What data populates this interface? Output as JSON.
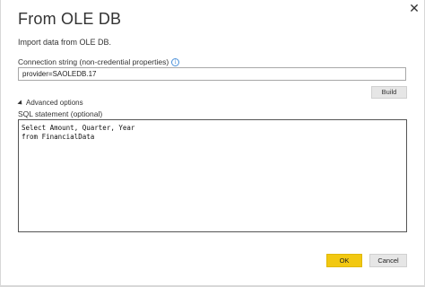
{
  "dialog": {
    "title": "From OLE DB",
    "close_glyph": "✕",
    "subtitle": "Import data from OLE DB."
  },
  "connection": {
    "label": "Connection string (non-credential properties)",
    "info_glyph": "i",
    "value": "provider=SAOLEDB.17"
  },
  "build_button": {
    "label": "Build"
  },
  "advanced": {
    "toggle_label": "Advanced options",
    "sql_label": "SQL statement (optional)",
    "sql_text": "Select Amount, Quarter, Year\nfrom FinancialData"
  },
  "footer": {
    "ok_label": "OK",
    "cancel_label": "Cancel"
  },
  "colors": {
    "ok_button": "#f2c811",
    "info_icon": "#4a90d9"
  },
  "icons": {
    "close": "close-icon",
    "info": "info-icon",
    "expand": "caret-expanded-icon"
  }
}
